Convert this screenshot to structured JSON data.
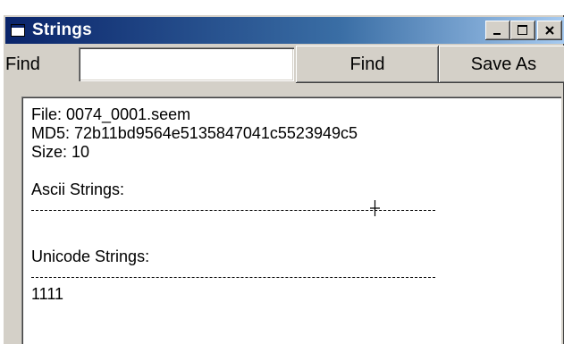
{
  "window": {
    "title": "Strings",
    "controls": {
      "minimize": "_",
      "maximize": "□",
      "close": "×"
    }
  },
  "toolbar": {
    "find_label": "Find",
    "find_value": "",
    "find_button": "Find",
    "save_as_button": "Save As"
  },
  "output": {
    "file_line": "File: 0074_0001.seem",
    "md5_line": "MD5:  72b11bd9564e5135847041c5523949c5",
    "size_line": "Size: 10",
    "ascii_header": "Ascii Strings:",
    "unicode_header": "Unicode Strings:",
    "unicode_value": "1111"
  },
  "icons": [
    "app-icon",
    "minimize-icon",
    "maximize-icon",
    "close-icon",
    "ibeam-cursor-icon"
  ],
  "colors": {
    "titlebar_start": "#0a246a",
    "titlebar_end": "#a6caf0",
    "face": "#d4d0c8"
  }
}
